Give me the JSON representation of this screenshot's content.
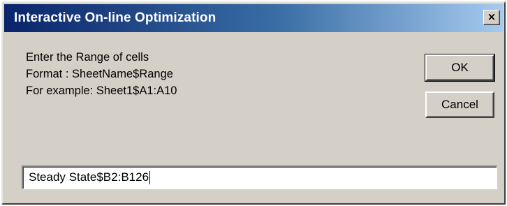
{
  "window": {
    "title": "Interactive On-line Optimization",
    "close_label": "×"
  },
  "message": {
    "line1": "Enter the Range of cells",
    "line2": "Format : SheetName$Range",
    "line3": "For example: Sheet1$A1:A10"
  },
  "buttons": {
    "ok_label": "OK",
    "cancel_label": "Cancel"
  },
  "range_input": {
    "value": "Steady State$B2:B126"
  },
  "colors": {
    "titlebar_start": "#0a246a",
    "titlebar_end": "#a6caf0",
    "dialog_face": "#d4d0c8"
  }
}
